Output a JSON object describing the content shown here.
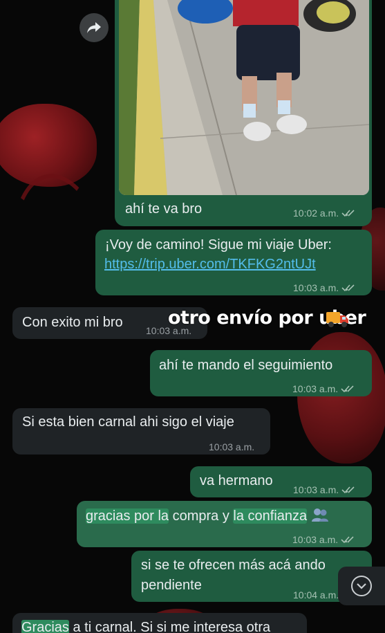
{
  "chat": {
    "photo_caption": "ahí te va bro",
    "photo_time": "10:02 a.m.",
    "messages": [
      {
        "dir": "out",
        "text": "¡Voy de camino! Sigue mi viaje Uber:",
        "link": "https://trip.uber.com/TKFKG2ntUJt",
        "time": "10:03 a.m."
      },
      {
        "dir": "in",
        "text": "Con exito mi bro",
        "time": "10:03 a.m."
      },
      {
        "dir": "out",
        "text": "ahí te mando el seguimiento",
        "time": "10:03 a.m."
      },
      {
        "dir": "in",
        "text": "Si esta bien carnal ahi sigo el viaje",
        "time": "10:03 a.m."
      },
      {
        "dir": "out",
        "text": "va hermano",
        "time": "10:03 a.m."
      },
      {
        "dir": "out",
        "parts": [
          "gracias por la",
          " compra y ",
          "la confianza"
        ],
        "time": "10:03 a.m."
      },
      {
        "dir": "out",
        "lines": [
          "si se te ofrecen más acá ando",
          "pendiente"
        ],
        "time": "10:04 a.m."
      },
      {
        "dir": "in",
        "parts": [
          "Gracias",
          " a ti carnal. Si si me interesa otra"
        ]
      }
    ],
    "sticker_text": "otro envío por uber"
  },
  "icons": {
    "forward": "forward-arrow-icon",
    "read": "double-check-icon",
    "scroll_down": "chevron-down-icon",
    "truck": "delivery-truck-icon"
  },
  "colors": {
    "outgoing_bubble": "#1f5c40",
    "incoming_bubble": "#1f2326",
    "link": "#53bdeb",
    "background": "#070707"
  }
}
